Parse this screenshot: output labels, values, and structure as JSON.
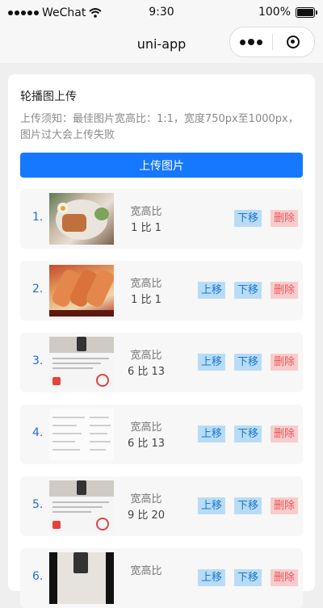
{
  "status": {
    "carrier": "WeChat",
    "time": "9:30",
    "battery": "100%"
  },
  "nav": {
    "title": "uni-app"
  },
  "page": {
    "title": "轮播图上传",
    "notice": "上传须知：最佳图片宽高比：1:1，宽度750px至1000px，图片过大会上传失败",
    "upload_label": "上传图片",
    "ratio_label": "宽高比",
    "up_label": "上移",
    "down_label": "下移",
    "delete_label": "删除"
  },
  "items": [
    {
      "index": "1.",
      "ratio": "1 比 1"
    },
    {
      "index": "2.",
      "ratio": "1 比 1"
    },
    {
      "index": "3.",
      "ratio": "6 比 13"
    },
    {
      "index": "4.",
      "ratio": "6 比 13"
    },
    {
      "index": "5.",
      "ratio": "9 比 20"
    },
    {
      "index": "6."
    }
  ],
  "colors": {
    "primary": "#1677ff",
    "move_bg": "#b9dcf6",
    "move_text": "#1677c8",
    "delete_bg": "#f9cccc",
    "delete_text": "#e85a5a"
  }
}
